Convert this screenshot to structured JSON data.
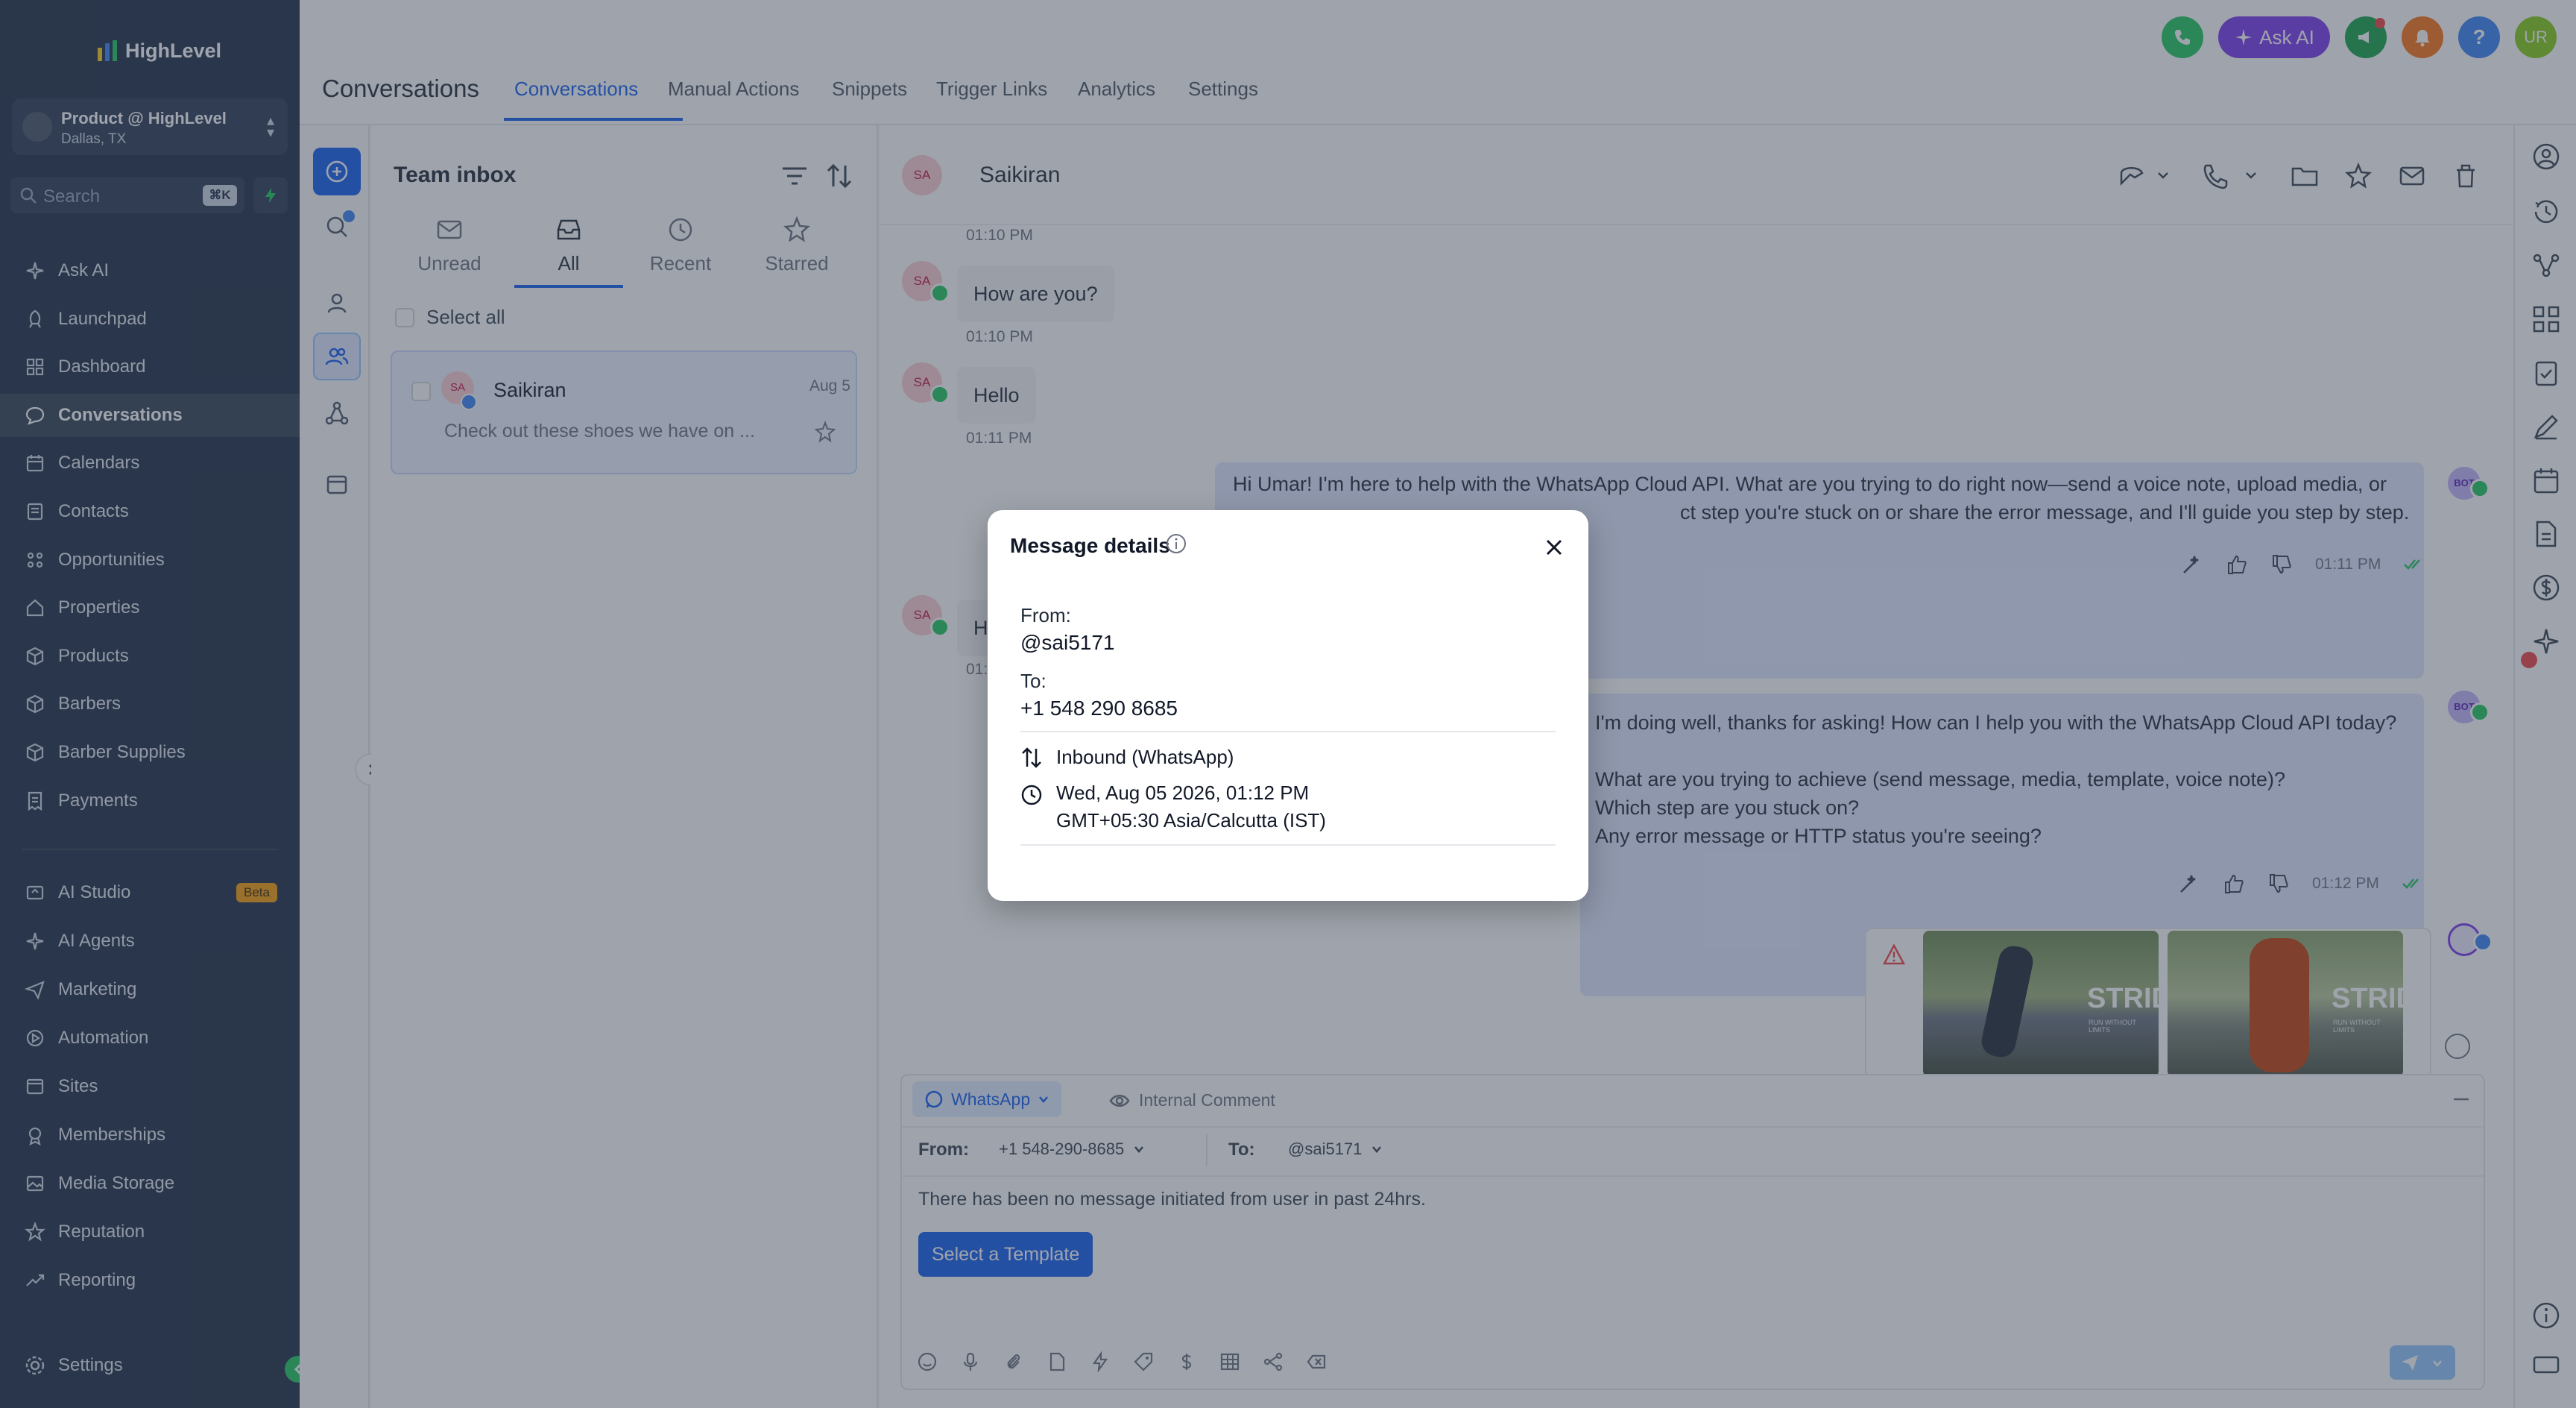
{
  "brand": {
    "name": "HighLevel"
  },
  "account": {
    "name": "Product @ HighLevel",
    "location": "Dallas, TX"
  },
  "sidebar": {
    "search_placeholder": "Search",
    "search_shortcut": "⌘K",
    "items": [
      {
        "label": "Ask AI",
        "icon": "sparkle-icon"
      },
      {
        "label": "Launchpad",
        "icon": "rocket-icon"
      },
      {
        "label": "Dashboard",
        "icon": "grid-icon"
      },
      {
        "label": "Conversations",
        "icon": "chat-bubble-icon",
        "active": true
      },
      {
        "label": "Calendars",
        "icon": "calendar-icon"
      },
      {
        "label": "Contacts",
        "icon": "contacts-icon"
      },
      {
        "label": "Opportunities",
        "icon": "opportunities-icon"
      },
      {
        "label": "Properties",
        "icon": "home-icon"
      },
      {
        "label": "Products",
        "icon": "box-icon"
      },
      {
        "label": "Barbers",
        "icon": "box-icon"
      },
      {
        "label": "Barber Supplies",
        "icon": "box-icon"
      },
      {
        "label": "Payments",
        "icon": "receipt-icon"
      }
    ],
    "items2": [
      {
        "label": "AI Studio",
        "icon": "ai-studio-icon",
        "badge": "Beta"
      },
      {
        "label": "AI Agents",
        "icon": "sparkle-icon"
      },
      {
        "label": "Marketing",
        "icon": "send-icon"
      },
      {
        "label": "Automation",
        "icon": "automation-icon"
      },
      {
        "label": "Sites",
        "icon": "sites-icon"
      },
      {
        "label": "Memberships",
        "icon": "membership-icon"
      },
      {
        "label": "Media Storage",
        "icon": "image-icon"
      },
      {
        "label": "Reputation",
        "icon": "star-icon"
      },
      {
        "label": "Reporting",
        "icon": "trend-icon"
      }
    ],
    "settings_label": "Settings"
  },
  "header": {
    "page_title": "Conversations",
    "tabs": [
      "Conversations",
      "Manual Actions",
      "Snippets",
      "Trigger Links",
      "Analytics",
      "Settings"
    ],
    "ask_ai": "Ask AI",
    "user_initials": "UR"
  },
  "inbox": {
    "title": "Team inbox",
    "tabs": [
      "Unread",
      "All",
      "Recent",
      "Starred"
    ],
    "select_all": "Select all",
    "conversation": {
      "initials": "SA",
      "name": "Saikiran",
      "date": "Aug 5",
      "preview": "Check out these shoes we have on ..."
    }
  },
  "chat": {
    "contact_initials": "SA",
    "contact_name": "Saikiran",
    "messages": [
      {
        "time": "01:10 PM"
      },
      {
        "text": "How are you?",
        "time": "01:10 PM"
      },
      {
        "text": "Hello",
        "time": "01:11 PM"
      },
      {
        "text_1": "Hi Umar! I'm here to help with the WhatsApp Cloud API. What are you trying to do right now—send a voice note, upload media, or",
        "text_2": "ct step you're stuck on or share the error message, and I'll guide you step by step.",
        "time": "01:11 PM"
      },
      {
        "text": "H",
        "time": "01:"
      },
      {
        "line1": "I'm doing well, thanks for asking! How can I help you with the WhatsApp Cloud API today?",
        "line2": "What are you trying to achieve (send message, media, template, voice note)?",
        "line3": "Which step are you stuck on?",
        "line4": "Any error message or HTTP status you're seeing?",
        "time": "01:12 PM"
      }
    ],
    "promo_text": "STRID",
    "promo_sub": "RUN WITHOUT LIMITS",
    "bot_badge": "BOT"
  },
  "composer": {
    "channel": "WhatsApp",
    "internal_comment": "Internal Comment",
    "from_label": "From:",
    "from_value": "+1 548-290-8685",
    "to_label": "To:",
    "to_value": "@sai5171",
    "notice": "There has been no message initiated from user in past 24hrs.",
    "template_button": "Select a Template"
  },
  "modal": {
    "title": "Message details",
    "from_label": "From:",
    "from_value": "@sai5171",
    "to_label": "To:",
    "to_value": "+1 548 290 8685",
    "direction": "Inbound (WhatsApp)",
    "date": "Wed, Aug 05 2026, 01:12 PM",
    "timezone": "GMT+05:30 Asia/Calcutta (IST)"
  },
  "colors": {
    "sidebar_bg": "#1f2d45",
    "accent": "#155eef",
    "whatsapp": "#22c55e",
    "ask_ai": "#7c3aed",
    "overlay": "rgba(55,65,81,0.48)"
  }
}
